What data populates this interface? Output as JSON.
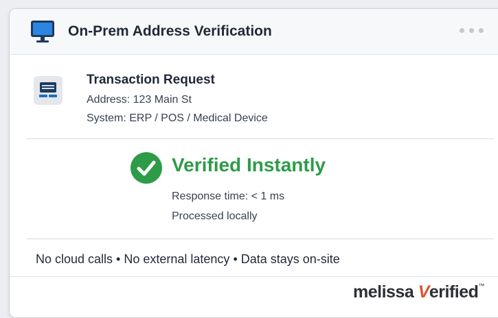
{
  "window": {
    "title": "On-Prem Address Verification"
  },
  "request": {
    "title": "Transaction Request",
    "address": "Address: 123 Main St",
    "system": "System: ERP / POS / Medical Device"
  },
  "result": {
    "status": "Verified Instantly",
    "response_time": "Response time: < 1 ms",
    "processing": "Processed locally"
  },
  "footer": {
    "note": "No cloud calls • No external latency • Data stays on-site"
  },
  "brand": {
    "name": "melissa",
    "v_letter": "V",
    "suffix": "erified",
    "tm": "™"
  },
  "colors": {
    "verified_green": "#2e9b48",
    "brand_orange": "#e0522a",
    "icon_navy": "#1e3a5f",
    "icon_blue": "#1f6fbf"
  },
  "icons": {
    "title": "monitor-icon",
    "request": "terminal-icon",
    "status": "check-circle-icon",
    "menu": "more-dots-icon"
  }
}
